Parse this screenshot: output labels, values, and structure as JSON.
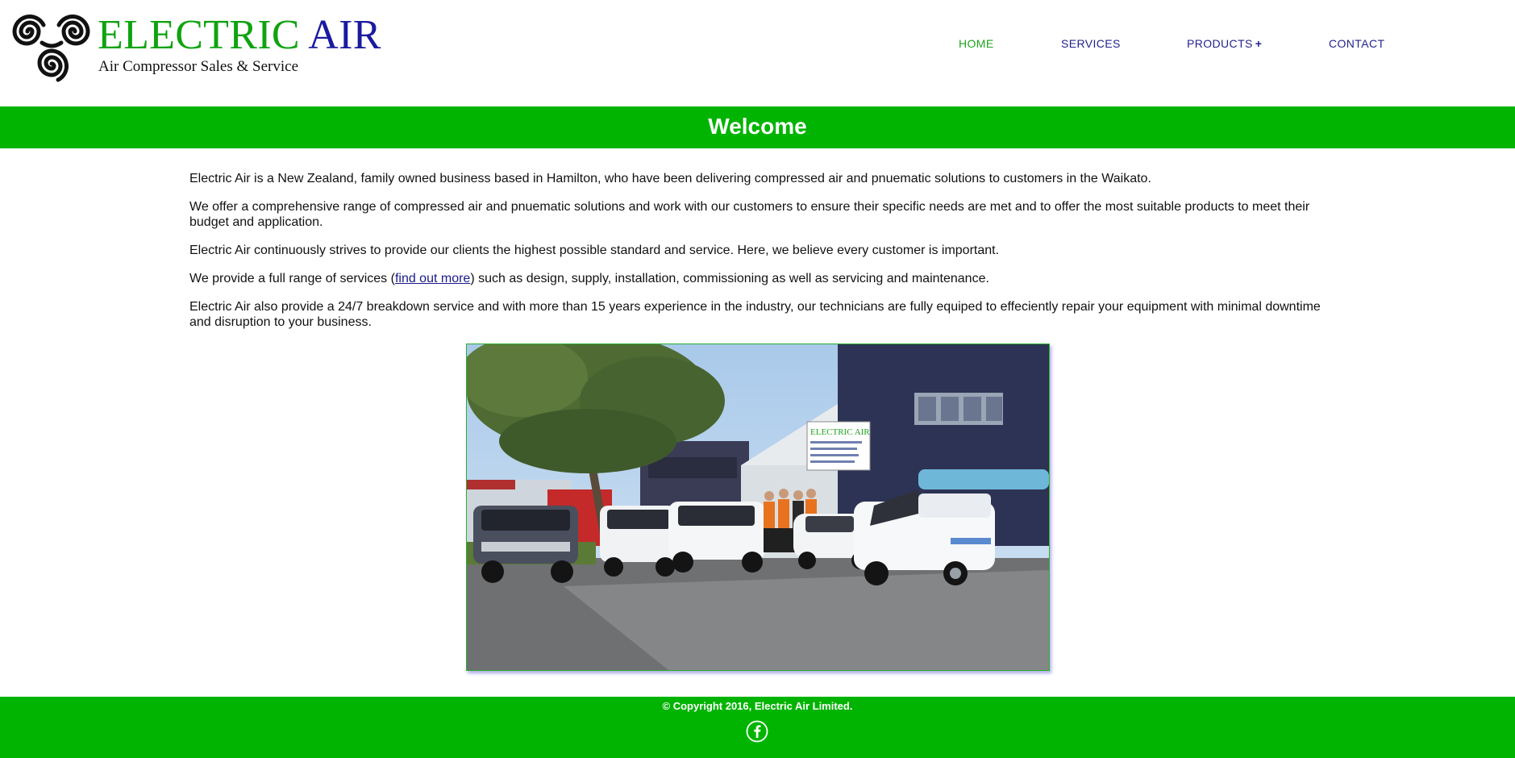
{
  "header": {
    "brand_first": "ELECTRIC",
    "brand_second": "AIR",
    "tagline": "Air Compressor Sales & Service",
    "logo_icon": "triple-spiral-icon"
  },
  "nav": {
    "items": [
      {
        "label": "HOME",
        "active": true
      },
      {
        "label": "SERVICES",
        "active": false
      },
      {
        "label": "PRODUCTS",
        "active": false,
        "suffix": "+"
      },
      {
        "label": "CONTACT",
        "active": false
      }
    ]
  },
  "banner": {
    "title": "Welcome"
  },
  "content": {
    "p1": "Electric Air is a New Zealand, family owned business based in Hamilton, who have been delivering compressed air and pnuematic solutions to customers in the Waikato.",
    "p2": "We offer a comprehensive range of compressed air and pnuematic solutions and work with our customers to ensure their specific needs are met and to offer the most suitable products to meet their budget and application.",
    "p3": "Electric Air continuously strives to provide our clients the highest possible standard and service. Here, we believe every customer is important.",
    "p4_before": "We provide a full range of services (",
    "p4_link": "find out more",
    "p4_after": ") such as design, supply, installation, commissioning as well as servicing and maintenance.",
    "p5": "Electric Air also provide a 24/7 breakdown service and with more than 15 years experience in the industry, our technicians are fully equiped to effeciently repair your equipment with minimal downtime and disruption to your business."
  },
  "photo": {
    "sign_line1": "ELECTRIC AIR"
  },
  "footer": {
    "copyright": "© Copyright 2016, Electric Air Limited.",
    "social_icon": "facebook-icon"
  },
  "colors": {
    "brand_green": "#02b402",
    "brand_blue": "#1a1aa0",
    "nav_blue": "#23238e",
    "nav_active": "#1fa31f",
    "text": "#111111"
  }
}
